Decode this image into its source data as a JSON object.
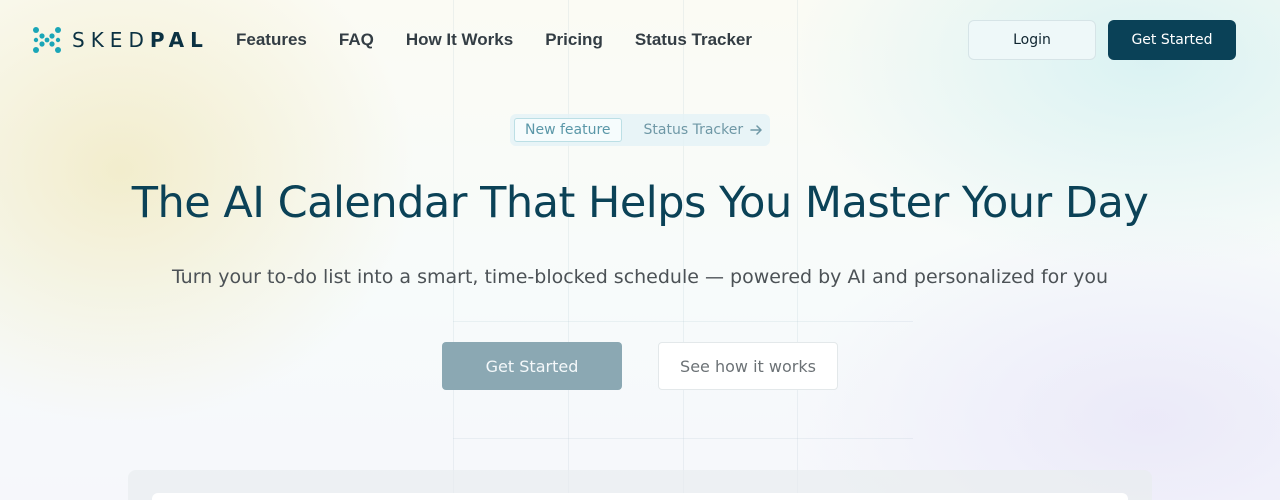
{
  "brand": {
    "name_light": "SKED",
    "name_bold": "PAL",
    "accent": "#1aa6b7",
    "primary": "#0a4157"
  },
  "nav": {
    "links": [
      "Features",
      "FAQ",
      "How It Works",
      "Pricing",
      "Status Tracker"
    ],
    "login_label": "Login",
    "get_started_label": "Get Started"
  },
  "badge": {
    "tag": "New feature",
    "link_label": "Status Tracker",
    "link_icon": "arrow-right-icon"
  },
  "hero": {
    "title": "The AI Calendar That Helps You Master Your Day",
    "subtitle": "Turn your to-do list into a smart, time-blocked schedule — powered by AI and personalized for you",
    "primary_cta": "Get Started",
    "secondary_cta": "See how it works"
  }
}
